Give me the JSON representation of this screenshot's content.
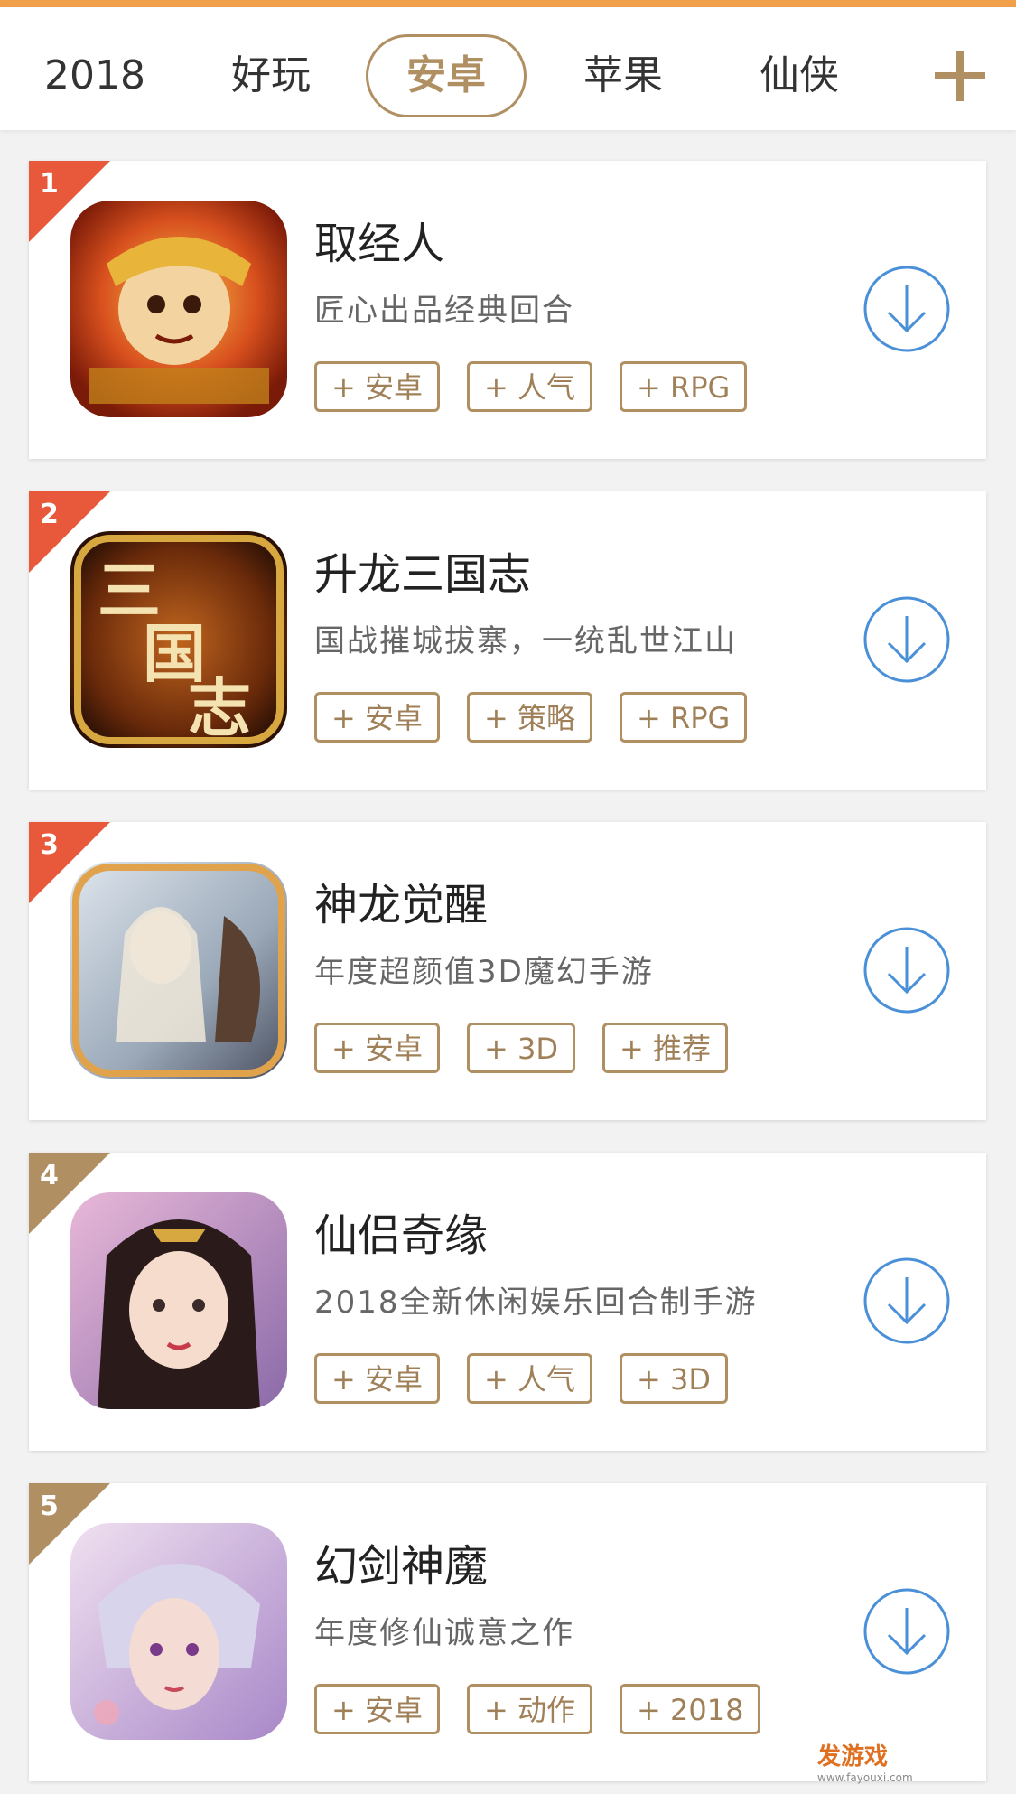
{
  "tabs": [
    {
      "label": "2018",
      "active": false
    },
    {
      "label": "好玩",
      "active": false
    },
    {
      "label": "安卓",
      "active": true
    },
    {
      "label": "苹果",
      "active": false
    },
    {
      "label": "仙侠",
      "active": false
    }
  ],
  "colors": {
    "accent": "#b09063",
    "rank_top": "#e8583a",
    "rank_other": "#b09063",
    "download_blue": "#4a90d9"
  },
  "games": [
    {
      "rank": "1",
      "name": "取经人",
      "desc": "匠心出品经典回合",
      "tags": [
        "+ 安卓",
        "+ 人气",
        "+ RPG"
      ]
    },
    {
      "rank": "2",
      "name": "升龙三国志",
      "desc": "国战摧城拔寨，一统乱世江山",
      "tags": [
        "+ 安卓",
        "+ 策略",
        "+ RPG"
      ]
    },
    {
      "rank": "3",
      "name": "神龙觉醒",
      "desc": "年度超颜值3D魔幻手游",
      "tags": [
        "+ 安卓",
        "+ 3D",
        "+ 推荐"
      ]
    },
    {
      "rank": "4",
      "name": "仙侣奇缘",
      "desc": "2018全新休闲娱乐回合制手游",
      "tags": [
        "+ 安卓",
        "+ 人气",
        "+ 3D"
      ]
    },
    {
      "rank": "5",
      "name": "幻剑神魔",
      "desc": "年度修仙诚意之作",
      "tags": [
        "+ 安卓",
        "+ 动作",
        "+ 2018"
      ]
    }
  ],
  "icons": {
    "add": "plus-icon",
    "download": "download-icon"
  },
  "watermark": {
    "brand": "发游戏",
    "url": "www.fayouxi.com"
  }
}
